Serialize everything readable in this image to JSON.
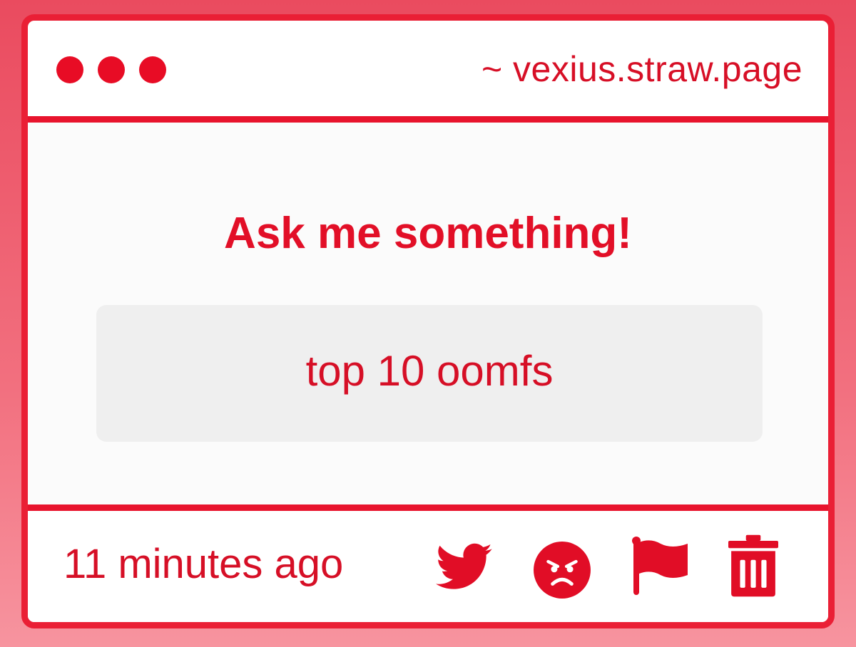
{
  "window": {
    "url": "~ vexius.straw.page"
  },
  "main": {
    "title": "Ask me something!",
    "question": "top 10 oomfs"
  },
  "footer": {
    "timestamp": "11 minutes ago",
    "actions": [
      {
        "icon": "twitter-icon"
      },
      {
        "icon": "angry-face-icon"
      },
      {
        "icon": "flag-icon"
      },
      {
        "icon": "trash-icon"
      }
    ]
  },
  "colors": {
    "accent": "#e8142d",
    "background_gradient_top": "#ea4b5f",
    "background_gradient_bottom": "#f7949f",
    "question_box": "#efefef"
  }
}
